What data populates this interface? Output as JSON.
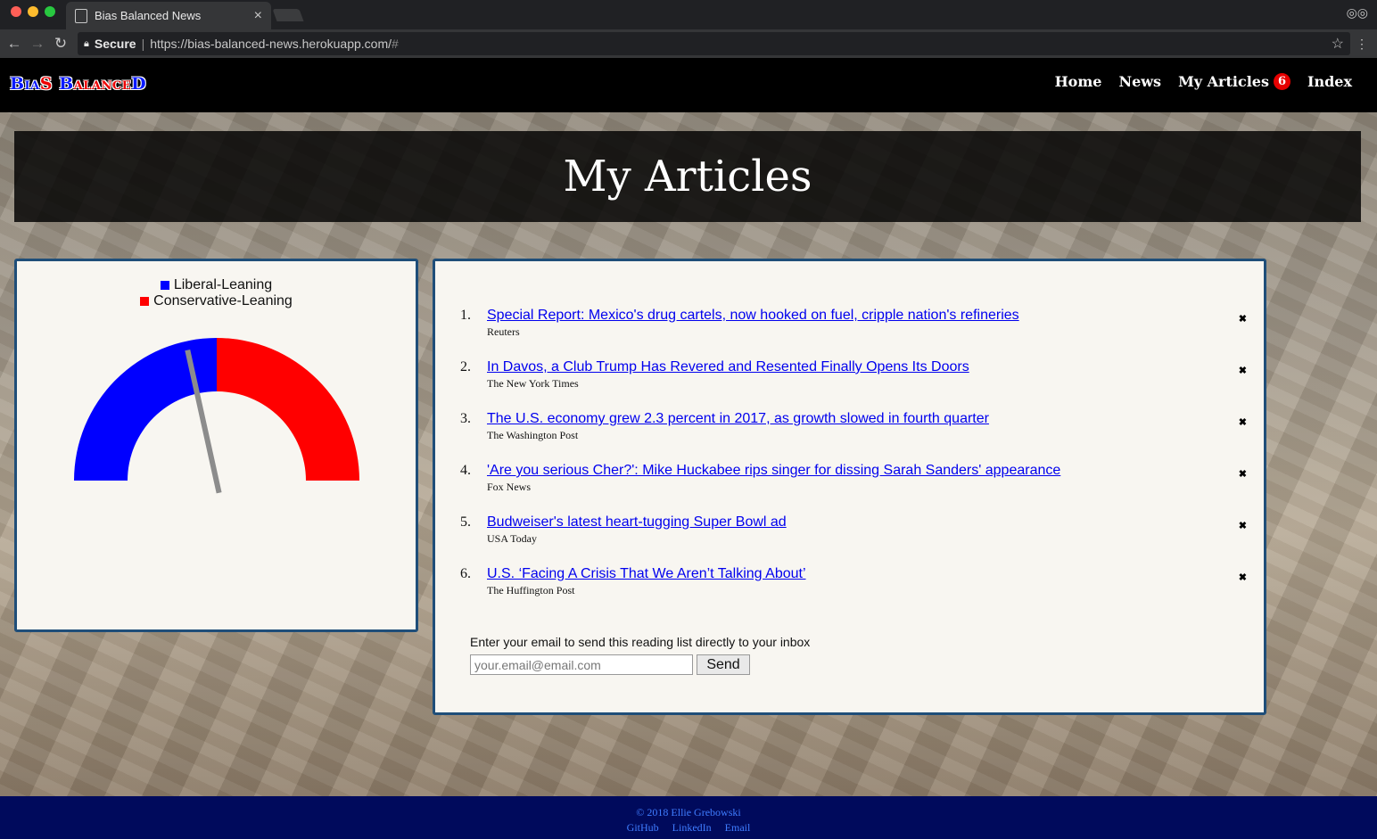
{
  "browser": {
    "tab_title": "Bias Balanced News",
    "tab_close": "×",
    "secure_label": "Secure",
    "url": "https://bias-balanced-news.herokuapp.com/",
    "url_hash": "#"
  },
  "navbar": {
    "brand_part1": "Bia",
    "brand_part2": "S",
    "brand_part3": " B",
    "brand_part4": "alance",
    "brand_part5": "D",
    "links": [
      {
        "label": "Home"
      },
      {
        "label": "News"
      },
      {
        "label": "My Articles",
        "badge": "6"
      },
      {
        "label": "Index"
      }
    ]
  },
  "main": {
    "page_title": "My Articles"
  },
  "gauge": {
    "legend": [
      {
        "label": "Liberal-Leaning",
        "color": "#0000ff"
      },
      {
        "label": "Conservative-Leaning",
        "color": "#ff0000"
      }
    ],
    "liberal_color": "#0000ff",
    "conservative_color": "#ff0000",
    "needle_color": "#8c8c8c",
    "needle_value": 0.43
  },
  "articles": [
    {
      "num": "1.",
      "title": "Special Report: Mexico's drug cartels, now hooked on fuel, cripple nation's refineries",
      "source": "Reuters"
    },
    {
      "num": "2.",
      "title": "In Davos, a Club Trump Has Revered and Resented Finally Opens Its Doors",
      "source": "The New York Times"
    },
    {
      "num": "3.",
      "title": "The U.S. economy grew 2.3 percent in 2017, as growth slowed in fourth quarter",
      "source": "The Washington Post"
    },
    {
      "num": "4.",
      "title": "'Are you serious Cher?': Mike Huckabee rips singer for dissing Sarah Sanders' appearance",
      "source": "Fox News"
    },
    {
      "num": "5.",
      "title": "Budweiser's latest heart-tugging Super Bowl ad",
      "source": "USA Today"
    },
    {
      "num": "6.",
      "title": "U.S. ‘Facing A Crisis That We Aren’t Talking About’",
      "source": "The Huffington Post"
    }
  ],
  "remove_glyph": "✖",
  "email_form": {
    "label": "Enter your email to send this reading list directly to your inbox",
    "placeholder": "your.email@email.com",
    "send_label": "Send"
  },
  "footer": {
    "copyright": "© 2018 Ellie Grebowski",
    "links": [
      "GitHub",
      "LinkedIn",
      "Email"
    ]
  }
}
